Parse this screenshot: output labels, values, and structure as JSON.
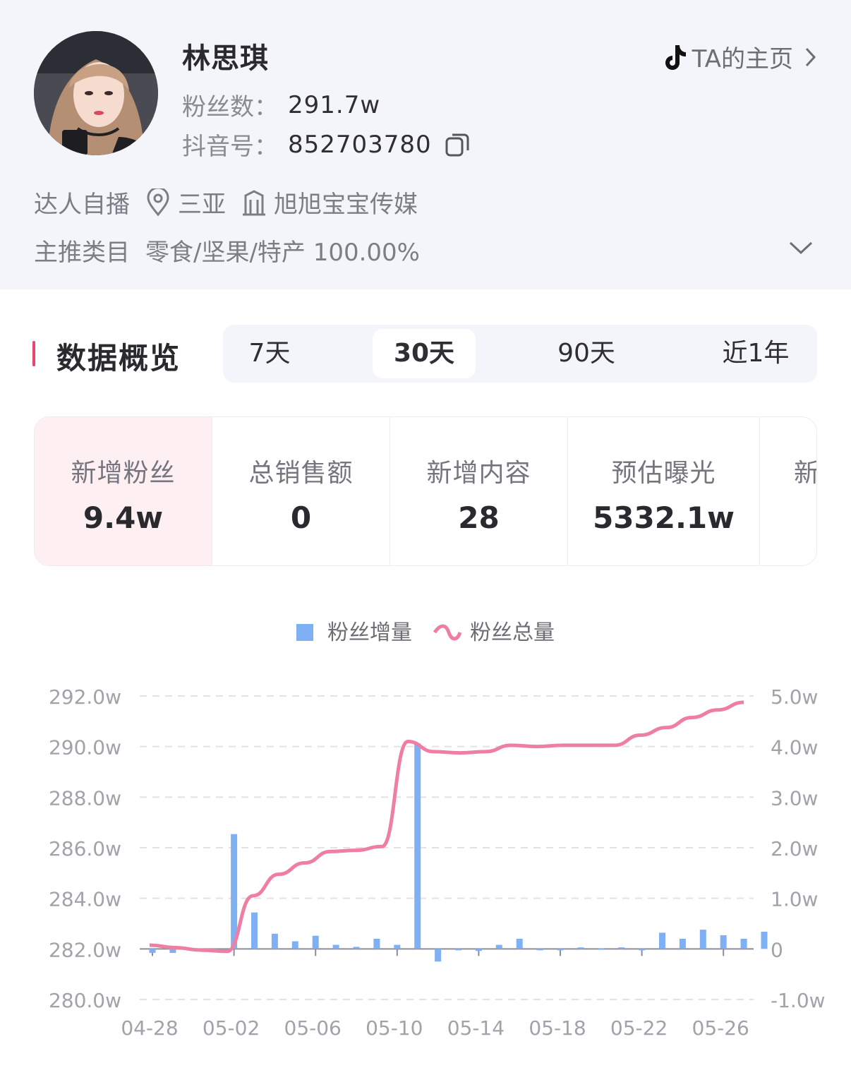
{
  "profile": {
    "name": "林思琪",
    "fans_label": "粉丝数：",
    "fans_value": "291.7w",
    "douyin_label": "抖音号：",
    "douyin_value": "852703780",
    "home_link": "TA的主页",
    "tag_type": "达人自播",
    "location": "三亚",
    "agency": "旭旭宝宝传媒",
    "category_label": "主推类目",
    "category_value": "零食/坚果/特产 100.00%"
  },
  "section": {
    "title": "数据概览"
  },
  "period_tabs": [
    {
      "label": "7天",
      "active": false
    },
    {
      "label": "30天",
      "active": true
    },
    {
      "label": "90天",
      "active": false
    },
    {
      "label": "近1年",
      "active": false
    }
  ],
  "metrics": [
    {
      "label": "新增粉丝",
      "value": "9.4w",
      "active": true
    },
    {
      "label": "总销售额",
      "value": "0",
      "active": false
    },
    {
      "label": "新增内容",
      "value": "28",
      "active": false
    },
    {
      "label": "预估曝光",
      "value": "5332.1w",
      "active": false
    },
    {
      "label": "新",
      "value": "",
      "active": false
    }
  ],
  "colors": {
    "accent": "#e9466f",
    "bar": "#7fb0f3",
    "line": "#ef7ea4",
    "active_card": "#fdeff2"
  },
  "icons": [
    "tiktok-icon",
    "chevron-right-icon",
    "copy-icon",
    "location-pin-icon",
    "building-icon",
    "chevron-down-icon"
  ],
  "chart_data": {
    "type": "bar+line",
    "legend_position": "top-center",
    "grid": true,
    "legend": [
      "粉丝增量",
      "粉丝总量"
    ],
    "x_tick_labels": [
      "04-28",
      "05-02",
      "05-06",
      "05-10",
      "05-14",
      "05-18",
      "05-22",
      "05-26"
    ],
    "y_left_ticks": [
      "292.0w",
      "290.0w",
      "288.0w",
      "286.0w",
      "284.0w",
      "282.0w",
      "280.0w"
    ],
    "y_right_ticks": [
      "5.0w",
      "4.0w",
      "3.0w",
      "2.0w",
      "1.0w",
      "0",
      "-1.0w"
    ],
    "ylim_left": [
      280,
      292
    ],
    "ylim_right": [
      -1,
      5
    ],
    "x": [
      "04-28",
      "04-29",
      "04-30",
      "05-01",
      "05-02",
      "05-03",
      "05-04",
      "05-05",
      "05-06",
      "05-07",
      "05-08",
      "05-09",
      "05-10",
      "05-11",
      "05-12",
      "05-13",
      "05-14",
      "05-15",
      "05-16",
      "05-17",
      "05-18",
      "05-19",
      "05-20",
      "05-21",
      "05-22",
      "05-23",
      "05-24",
      "05-25",
      "05-26",
      "05-27"
    ],
    "series": [
      {
        "name": "粉丝增量",
        "type": "bar",
        "axis": "right",
        "values": [
          -0.08,
          -0.08,
          -0.04,
          -0.03,
          2.27,
          0.72,
          0.3,
          0.15,
          0.26,
          0.08,
          0.04,
          0.2,
          0.08,
          4.06,
          -0.25,
          0.0,
          -0.04,
          0.08,
          0.2,
          0.0,
          -0.02,
          0.03,
          0.01,
          0.03,
          0.0,
          0.32,
          0.2,
          0.38,
          0.27,
          0.2,
          0.34
        ]
      },
      {
        "name": "粉丝总量",
        "type": "line",
        "axis": "left",
        "values": [
          282.15,
          282.05,
          281.95,
          281.9,
          284.1,
          284.95,
          285.4,
          285.85,
          285.9,
          286.05,
          290.2,
          289.8,
          289.75,
          289.8,
          290.05,
          290.0,
          290.05,
          290.05,
          290.05,
          290.45,
          290.75,
          291.15,
          291.45,
          291.75
        ]
      }
    ]
  }
}
